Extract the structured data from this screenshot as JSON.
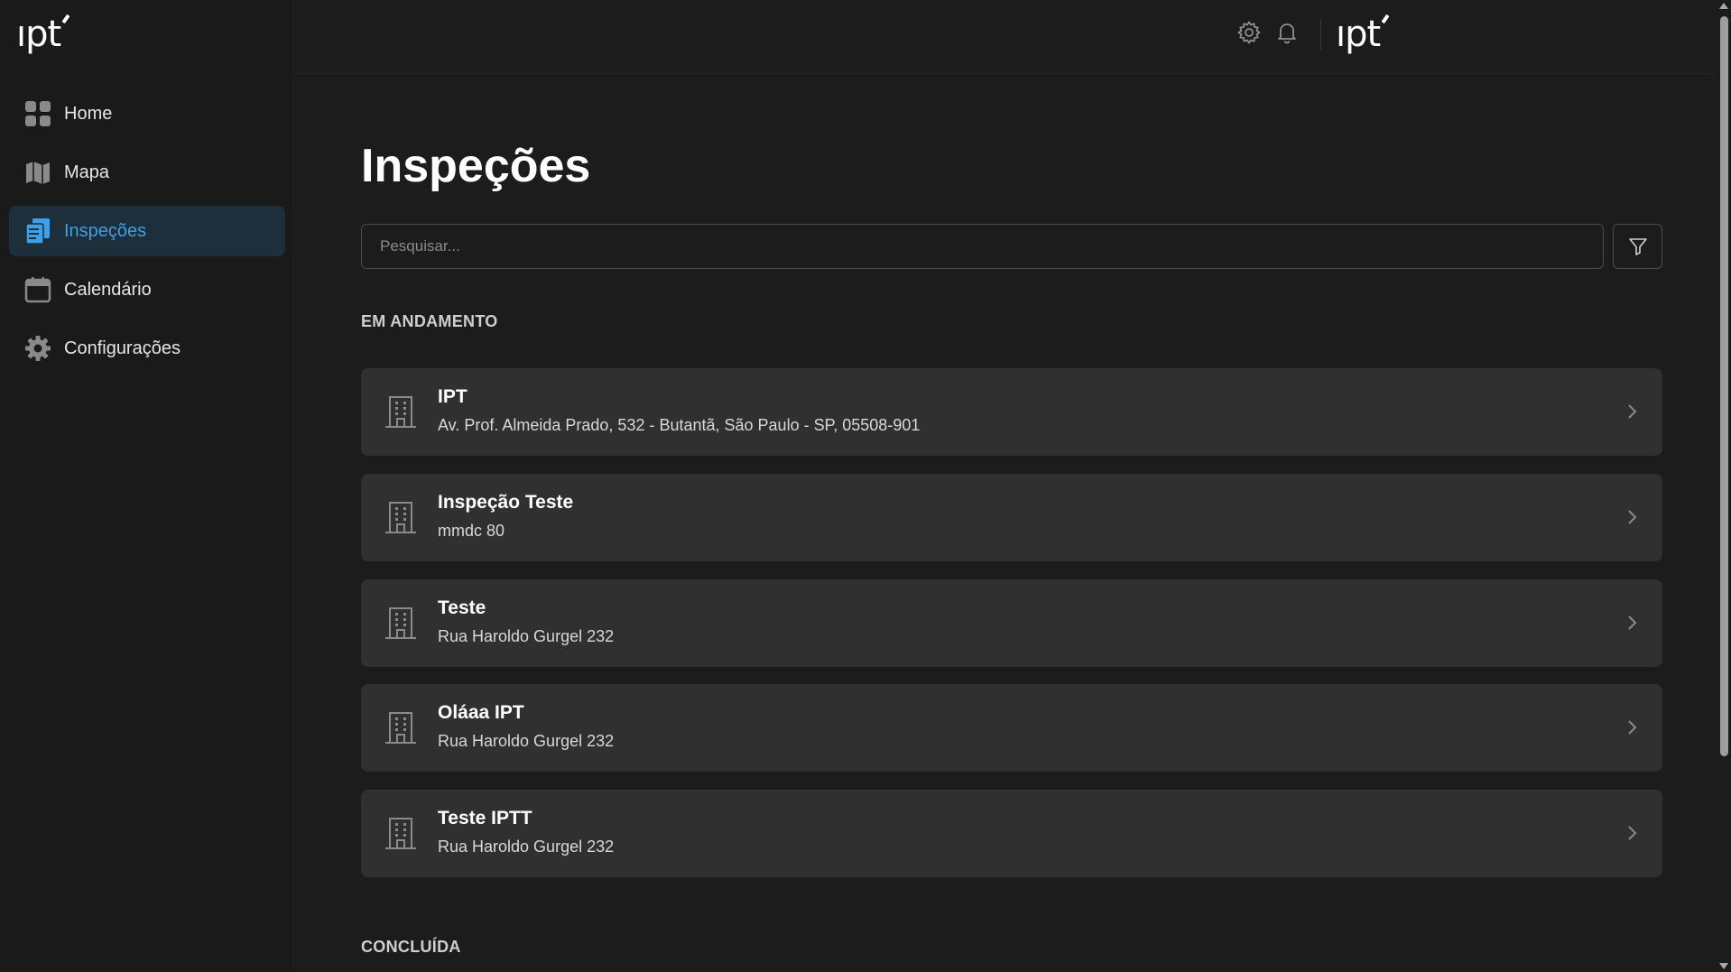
{
  "brand": {
    "logo_text": "ıpt"
  },
  "sidebar": {
    "items": [
      {
        "label": "Home",
        "icon": "grid-icon",
        "active": false
      },
      {
        "label": "Mapa",
        "icon": "map-icon",
        "active": false
      },
      {
        "label": "Inspeções",
        "icon": "documents-icon",
        "active": true
      },
      {
        "label": "Calendário",
        "icon": "calendar-icon",
        "active": false
      },
      {
        "label": "Configurações",
        "icon": "gear-icon",
        "active": false
      }
    ]
  },
  "header": {
    "icons": [
      "settings-icon",
      "bell-icon"
    ],
    "logo_text": "ıpt"
  },
  "main": {
    "title": "Inspeções",
    "search": {
      "placeholder": "Pesquisar...",
      "value": ""
    },
    "filter_icon": "filter-icon",
    "sections": [
      {
        "title": "EM ANDAMENTO",
        "items": [
          {
            "title": "IPT",
            "address": "Av. Prof. Almeida Prado, 532 - Butantã, São Paulo - SP, 05508-901"
          },
          {
            "title": "Inspeção Teste",
            "address": "mmdc 80"
          },
          {
            "title": "Teste",
            "address": "Rua Haroldo Gurgel 232"
          },
          {
            "title": "Oláaa IPT",
            "address": "Rua Haroldo Gurgel 232"
          },
          {
            "title": "Teste IPTT",
            "address": "Rua Haroldo Gurgel 232"
          }
        ]
      },
      {
        "title": "CONCLUÍDA",
        "items": []
      }
    ]
  },
  "colors": {
    "background": "#1c1c1c",
    "card": "#303030",
    "accent": "#3fa0e6",
    "active_bg": "#1d2f3a"
  }
}
